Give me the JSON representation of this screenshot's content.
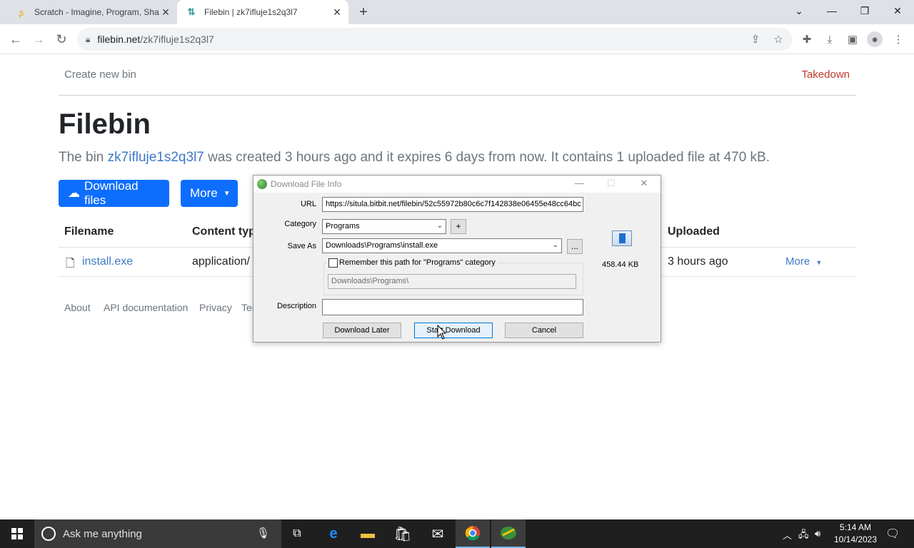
{
  "browser": {
    "tabs": [
      {
        "title": "Scratch - Imagine, Program, Sha",
        "favicon": "scratch-icon"
      },
      {
        "title": "Filebin | zk7ifluje1s2q3l7",
        "favicon": "filebin-icon"
      }
    ],
    "url_host": "filebin.net",
    "url_path": "/zk7ifluje1s2q3l7"
  },
  "page": {
    "nav_left": "Create new bin",
    "nav_right": "Takedown",
    "title": "Filebin",
    "lead_prefix": "The bin ",
    "lead_link": "zk7ifluje1s2q3l7",
    "lead_suffix": " was created 3 hours ago and it expires 6 days from now. It contains 1 uploaded file at 470 kB.",
    "download_button": "Download files",
    "more_button": "More",
    "table": {
      "headers": [
        "Filename",
        "Content typ",
        "Uploaded"
      ],
      "row": {
        "filename": "install.exe",
        "content_type": "application/",
        "uploaded": "3 hours ago",
        "more": "More"
      }
    },
    "footer": [
      "About",
      "API documentation",
      "Privacy",
      "Ter"
    ]
  },
  "dialog": {
    "title": "Download File Info",
    "url_label": "URL",
    "url_value": "https://situla.bitbit.net/filebin/52c55972b80c6c7f142838e06455e48cc64bc",
    "category_label": "Category",
    "category_value": "Programs",
    "save_as_label": "Save As",
    "save_as_value": "Downloads\\Programs\\install.exe",
    "remember_label": "Remember this path for \"Programs\" category",
    "path_value": "Downloads\\Programs\\",
    "description_label": "Description",
    "description_value": "",
    "file_size": "458.44  KB",
    "buttons": {
      "later": "Download Later",
      "start": "Start Download",
      "cancel": "Cancel"
    },
    "plus": "+",
    "browse": "..."
  },
  "taskbar": {
    "search_placeholder": "Ask me anything",
    "time": "5:14 AM",
    "date": "10/14/2023"
  },
  "colors": {
    "accent": "#0d6efd",
    "link": "#3d79c7",
    "takedown": "#c0392b"
  }
}
